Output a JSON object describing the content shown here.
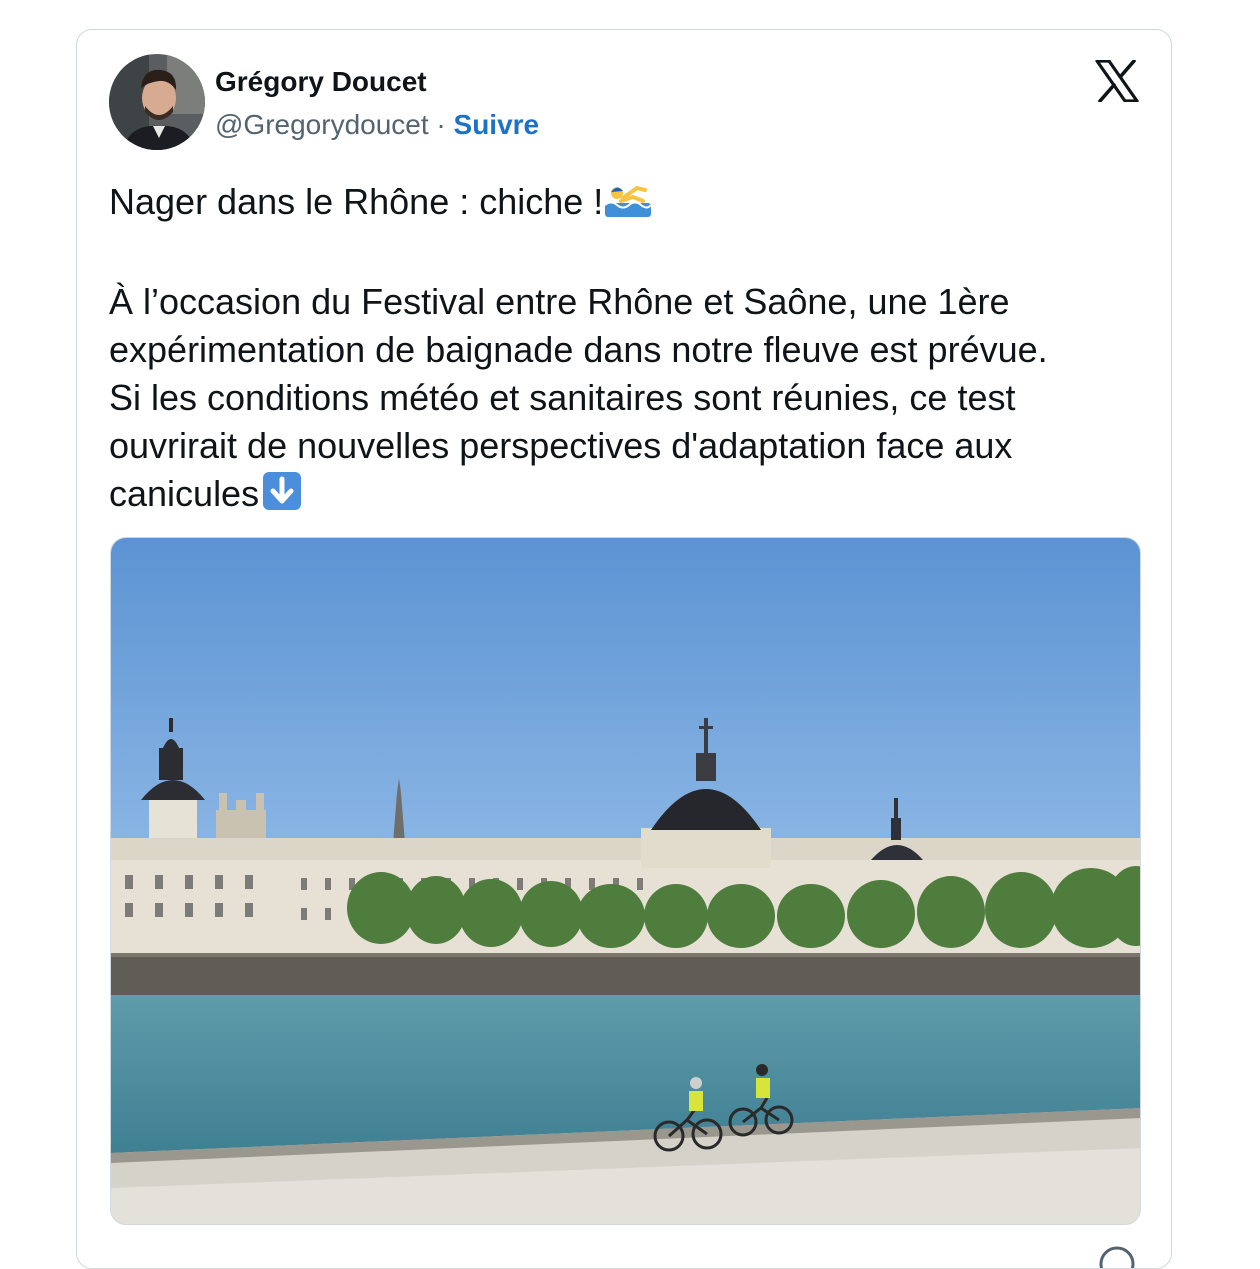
{
  "tweet": {
    "author": {
      "name": "Grégory Doucet",
      "handle": "@Gregorydoucet",
      "separator": " · ",
      "follow_label": "Suivre"
    },
    "platform_icon": "x-logo-icon",
    "text_line1": "Nager dans le Rhône : chiche !",
    "text_line1_emoji": "swimmer-emoji",
    "paragraph_lines": [
      "À l’occasion du Festival entre Rhône et Saône, une 1ère",
      "expérimentation de baignade dans notre fleuve est prévue.",
      "Si les conditions météo et sanitaires sont réunies, ce test",
      "ouvrirait de nouvelles perspectives d'adaptation face aux",
      "canicules"
    ],
    "paragraph_end_emoji": "down-arrow-emoji",
    "media": {
      "kind": "photo",
      "subject": "riverside-buildings-photo"
    }
  },
  "colors": {
    "text": "#0f1419",
    "secondary": "#536471",
    "link": "#1d72c7",
    "border": "#cfd9de",
    "sky": "#5f98d6",
    "river": "#4e8fa0",
    "emoji_blue": "#4b8edc"
  }
}
